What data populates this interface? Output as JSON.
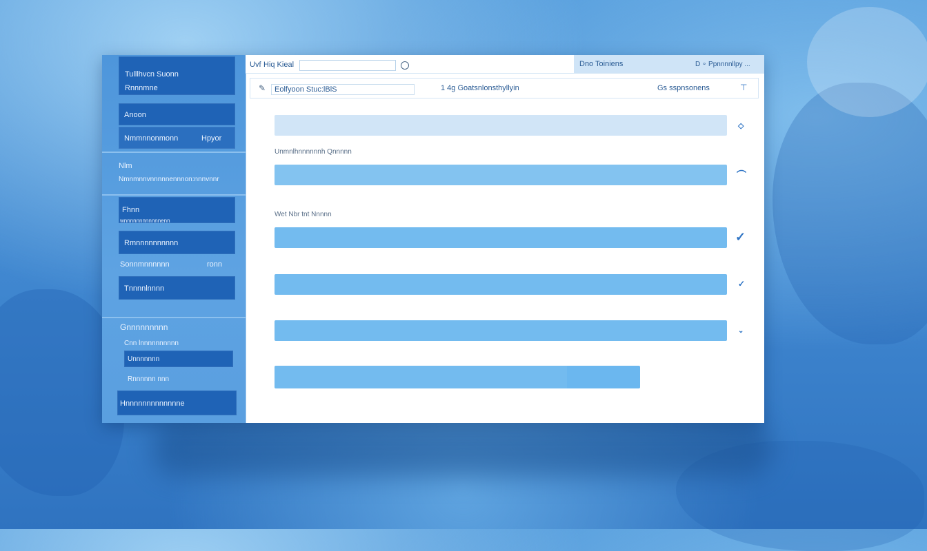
{
  "window": {
    "title_left": "Uvf",
    "title_tag": "Hiq Kieal",
    "title_right": "Dno Toiniens",
    "user_menu": "D ∘ Ppnnnnllpy ...",
    "search_value": ""
  },
  "toolbar": {
    "field_text": "Eolfyoon Stuc:lBlS",
    "center_text": "1 4g Goatsnlonsthyllyin",
    "right_text": "Gs  sspnsonens"
  },
  "sidebar": {
    "header_line1": "Tulllhvcn Suonn",
    "header_line2": "Rnnnmne",
    "item1": "Anoon",
    "item2_left": "Nmmnnonmonn",
    "item2_right": "Hpyor",
    "group1_title": "Nlm",
    "group1_sub": "Nmnmnnvnnnnnennnon:nnnvnnr",
    "item3": "Fhnn",
    "item3_sub": "wnnnnnnnnnnnnenn",
    "item4": "Rmnnnnnnnnnn",
    "item5_left": "Sonnmnnnnnn",
    "item5_right": "ronn",
    "item6": "Tnnnnlnnnn",
    "group2_title": "Gnnnnnnnnn",
    "group2_sub": "Cnn lnnnnnnnnnn",
    "item7": "Unnnnnnn",
    "item8": "Rnnnnnn nnn",
    "item9": "Hnnnnnnnnnnnnne"
  },
  "main": {
    "label1": "Unmnlhnnnnnnh Qnnnnn",
    "label2": "Wet  Nbr  tnt Nnnnn"
  },
  "progress": [
    1.0,
    1.0,
    1.0,
    1.0,
    1.0,
    0.8
  ],
  "colors": {
    "sidebar_item": "#1f63b6",
    "bar_light": "#cfe4f7",
    "bar_mid": "#7cc0f0",
    "bar_strong": "#6bb7ef",
    "accent": "#2d73c4"
  }
}
